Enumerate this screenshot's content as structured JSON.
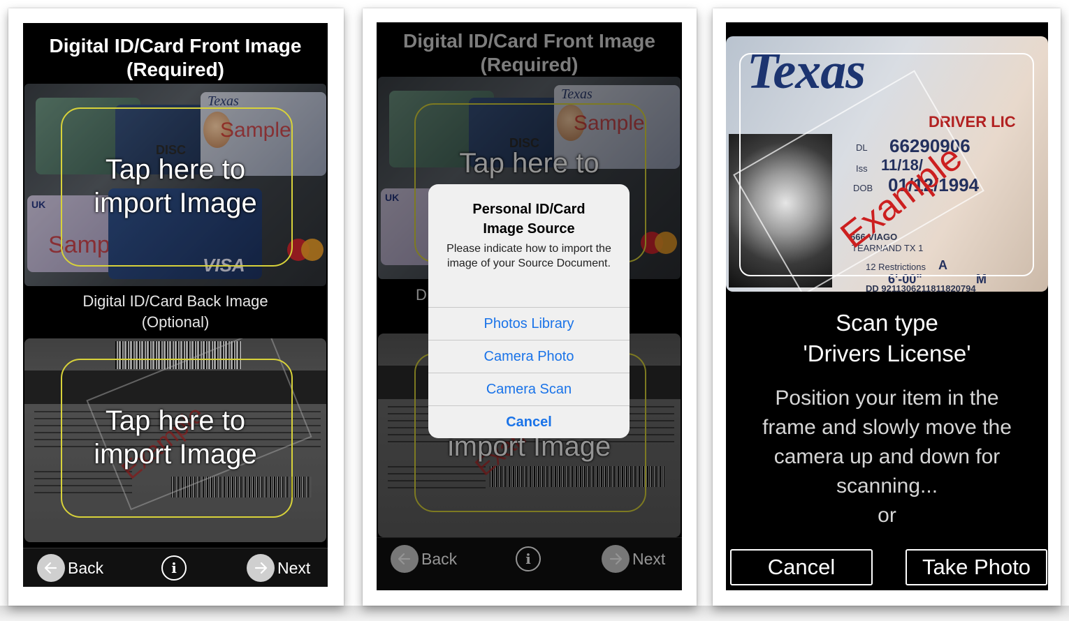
{
  "phone1": {
    "front_title": "Digital ID/Card Front Image (Required)",
    "front_tap": "Tap here to import Image",
    "back_title": "Digital ID/Card Back Image (Optional)",
    "back_tap": "Tap here to import Image",
    "nav": {
      "back": "Back",
      "next": "Next",
      "info_icon": "info-icon"
    }
  },
  "phone2": {
    "front_title": "Digital ID/Card Front Image (Required)",
    "front_tap_partial": "Tap here to",
    "back_tap_partial": "import Image",
    "back_title_partial": "D",
    "dialog": {
      "title": "Personal ID/Card Image Source",
      "message": "Please indicate how to import the image of your Source Document.",
      "options": [
        "Photos Library",
        "Camera Photo",
        "Camera Scan",
        "Cancel"
      ]
    },
    "nav": {
      "back": "Back",
      "next": "Next"
    }
  },
  "phone3": {
    "license": {
      "state": "Texas",
      "header": "DRIVER LIC",
      "dl": "66290906",
      "iss": "11/18/",
      "dob": "01/12/1994",
      "watermark": "Example",
      "address1": "666 VIAGO",
      "address2": "TEARNAND TX 1",
      "restrictions": "A",
      "height": "6'-00\"",
      "sex": "M",
      "dd": "DD 9211306211811820794"
    },
    "scan_type_line1": "Scan type",
    "scan_type_line2": "'Drivers License'",
    "instructions": [
      "Position your item in the",
      "frame and slowly move the",
      "camera up and down for",
      "scanning...",
      "or"
    ],
    "cancel": "Cancel",
    "take_photo": "Take Photo"
  },
  "sample_text": {
    "texas": "Texas",
    "sample": "Sample",
    "disc": "DISC",
    "visa": "VISA",
    "uk": "UK",
    "example": "Example"
  },
  "colors": {
    "accent_blue": "#1a73e8",
    "tap_frame": "#d8d23a",
    "watermark_red": "#c02020"
  }
}
